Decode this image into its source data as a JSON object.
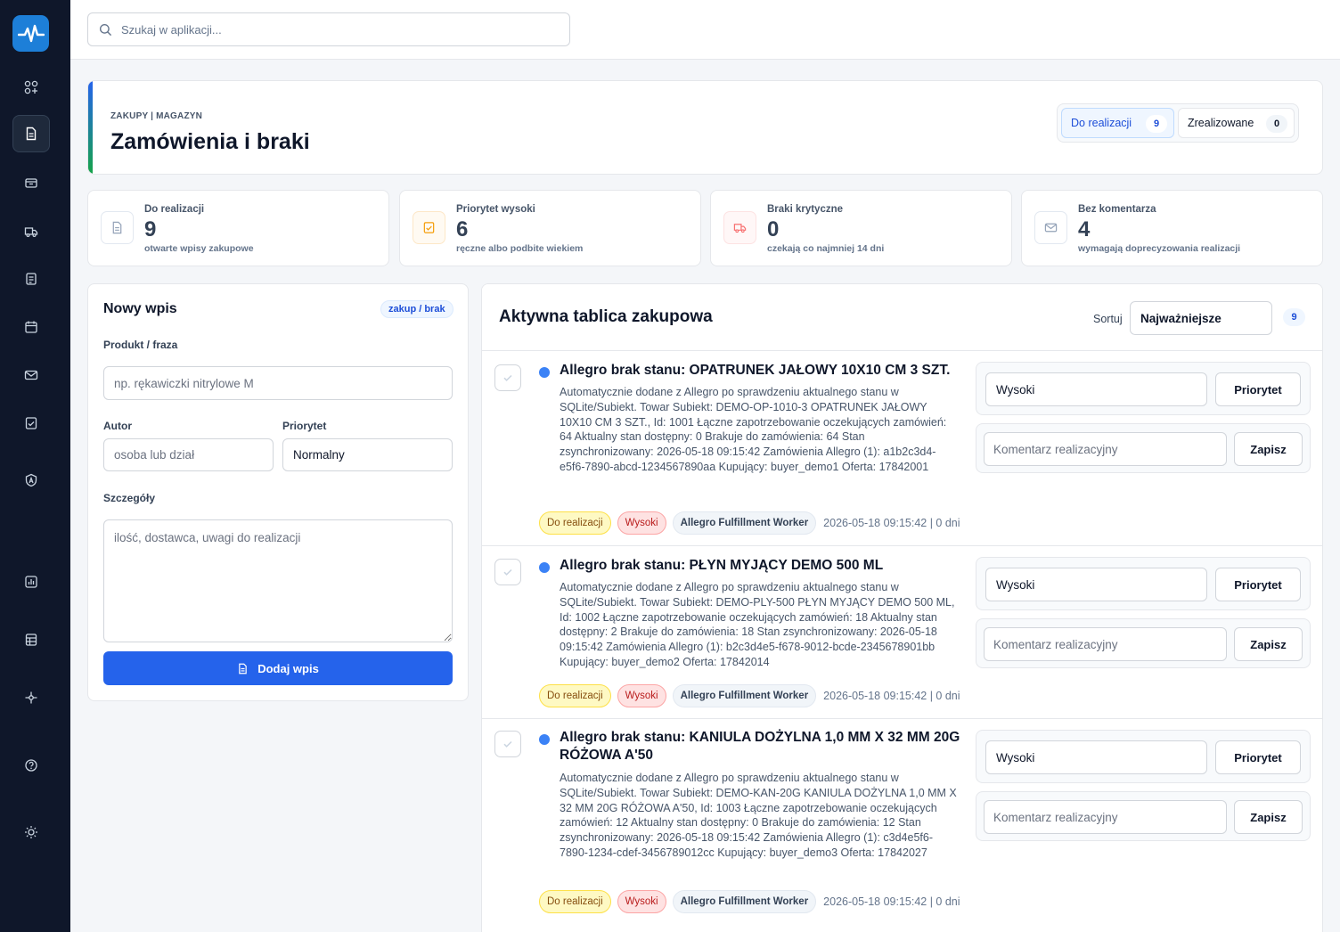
{
  "search": {
    "placeholder": "Szukaj w aplikacji..."
  },
  "header": {
    "breadcrumb": "ZAKUPY | MAGAZYN",
    "title": "Zamówienia i braki",
    "tabs": [
      {
        "label": "Do realizacji",
        "count": "9"
      },
      {
        "label": "Zrealizowane",
        "count": "0"
      }
    ]
  },
  "stats": [
    {
      "label": "Do realizacji",
      "value": "9",
      "sub": "otwarte wpisy zakupowe",
      "icon": "document-icon",
      "color": "#94a3b8"
    },
    {
      "label": "Priorytet wysoki",
      "value": "6",
      "sub": "ręczne albo podbite wiekiem",
      "icon": "checklist-icon",
      "color": "#f59e0b"
    },
    {
      "label": "Braki krytyczne",
      "value": "0",
      "sub": "czekają co najmniej 14 dni",
      "icon": "truck-icon",
      "color": "#f87171"
    },
    {
      "label": "Bez komentarza",
      "value": "4",
      "sub": "wymagają doprecyzowania realizacji",
      "icon": "mail-icon",
      "color": "#94a3b8"
    }
  ],
  "form": {
    "title": "Nowy wpis",
    "badge": "zakup / brak",
    "product_label": "Produkt / fraza",
    "product_placeholder": "np. rękawiczki nitrylowe M",
    "author_label": "Autor",
    "author_placeholder": "osoba lub dział",
    "priority_label": "Priorytet",
    "priority_value": "Normalny",
    "details_label": "Szczegóły",
    "details_placeholder": "ilość, dostawca, uwagi do realizacji",
    "submit_label": "Dodaj wpis"
  },
  "board": {
    "title": "Aktywna tablica zakupowa",
    "sort_label": "Sortuj",
    "sort_value": "Najważniejsze",
    "count": "9",
    "priority_button": "Priorytet",
    "comment_placeholder": "Komentarz realizacyjny",
    "save_button": "Zapisz",
    "items": [
      {
        "title": "Allegro brak stanu: OPATRUNEK JAŁOWY 10X10 CM 3 SZT.",
        "description": "Automatycznie dodane z Allegro po sprawdzeniu aktualnego stanu w SQLite/Subiekt. Towar Subiekt: DEMO-OP-1010-3 OPATRUNEK JAŁOWY 10X10 CM 3 SZT., Id: 1001 Łączne zapotrzebowanie oczekujących zamówień: 64 Aktualny stan dostępny: 0 Brakuje do zamówienia: 64 Stan zsynchronizowany: 2026-05-18 09:15:42 Zamówienia Allegro (1): a1b2c3d4-e5f6-7890-abcd-1234567890aa Kupujący: buyer_demo1 Oferta: 17842001",
        "status": "Do realizacji",
        "priority": "Wysoki",
        "worker": "Allegro Fulfillment Worker",
        "meta": "2026-05-18 09:15:42 | 0 dni",
        "priority_select": "Wysoki"
      },
      {
        "title": "Allegro brak stanu: PŁYN MYJĄCY DEMO 500 ML",
        "description": "Automatycznie dodane z Allegro po sprawdzeniu aktualnego stanu w SQLite/Subiekt. Towar Subiekt: DEMO-PLY-500 PŁYN MYJĄCY DEMO 500 ML, Id: 1002 Łączne zapotrzebowanie oczekujących zamówień: 18 Aktualny stan dostępny: 2 Brakuje do zamówienia: 18 Stan zsynchronizowany: 2026-05-18 09:15:42 Zamówienia Allegro (1): b2c3d4e5-f678-9012-bcde-2345678901bb Kupujący: buyer_demo2 Oferta: 17842014",
        "status": "Do realizacji",
        "priority": "Wysoki",
        "worker": "Allegro Fulfillment Worker",
        "meta": "2026-05-18 09:15:42 | 0 dni",
        "priority_select": "Wysoki"
      },
      {
        "title": "Allegro brak stanu: KANIULA DOŻYLNA 1,0 MM X 32 MM 20G RÓŻOWA A'50",
        "description": "Automatycznie dodane z Allegro po sprawdzeniu aktualnego stanu w SQLite/Subiekt. Towar Subiekt: DEMO-KAN-20G KANIULA DOŻYLNA 1,0 MM X 32 MM 20G RÓŻOWA A'50, Id: 1003 Łączne zapotrzebowanie oczekujących zamówień: 12 Aktualny stan dostępny: 0 Brakuje do zamówienia: 12 Stan zsynchronizowany: 2026-05-18 09:15:42 Zamówienia Allegro (1): c3d4e5f6-7890-1234-cdef-3456789012cc Kupujący: buyer_demo3 Oferta: 17842027",
        "status": "Do realizacji",
        "priority": "Wysoki",
        "worker": "Allegro Fulfillment Worker",
        "meta": "2026-05-18 09:15:42 | 0 dni",
        "priority_select": "Wysoki"
      }
    ]
  },
  "colors": {
    "accent": "#2563eb",
    "sidebar": "#0f172a",
    "status_dot": "#3b82f6"
  }
}
